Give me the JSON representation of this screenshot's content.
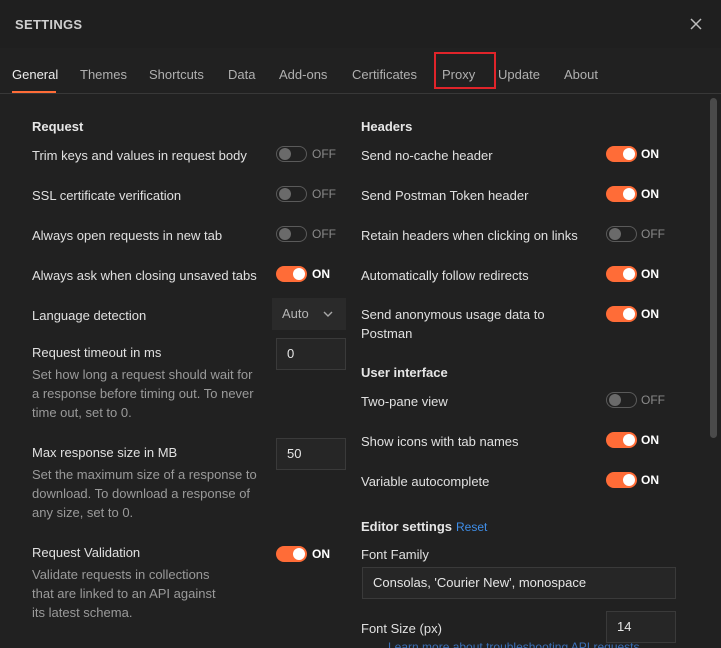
{
  "window": {
    "title": "SETTINGS"
  },
  "tabs": [
    {
      "label": "General"
    },
    {
      "label": "Themes"
    },
    {
      "label": "Shortcuts"
    },
    {
      "label": "Data"
    },
    {
      "label": "Add-ons"
    },
    {
      "label": "Certificates"
    },
    {
      "label": "Proxy"
    },
    {
      "label": "Update"
    },
    {
      "label": "About"
    }
  ],
  "active_tab": "General",
  "accent_color": "#ff6c37",
  "highlight_color": "#e0242a",
  "request": {
    "heading": "Request",
    "trim_keys": {
      "label": "Trim keys and values in request body",
      "state": "OFF"
    },
    "ssl_verification": {
      "label": "SSL certificate verification",
      "state": "OFF"
    },
    "open_new_tab": {
      "label": "Always open requests in new tab",
      "state": "OFF"
    },
    "ask_closing": {
      "label": "Always ask when closing unsaved tabs",
      "state": "ON"
    },
    "language_detection": {
      "label": "Language detection",
      "value": "Auto"
    },
    "timeout": {
      "label": "Request timeout in ms",
      "desc": "Set how long a request should wait for a response before timing out. To never time out, set to 0.",
      "value": "0"
    },
    "max_response": {
      "label": "Max response size in MB",
      "desc": "Set the maximum size of a response to download. To download a response of any size, set to 0.",
      "value": "50"
    },
    "validation": {
      "label": "Request Validation",
      "desc": "Validate requests in collections that are linked to an API against its latest schema.",
      "state": "ON"
    }
  },
  "headers": {
    "heading": "Headers",
    "no_cache": {
      "label": "Send no-cache header",
      "state": "ON"
    },
    "postman_token": {
      "label": "Send Postman Token header",
      "state": "ON"
    },
    "retain_headers": {
      "label": "Retain headers when clicking on links",
      "state": "OFF"
    },
    "follow_redirects": {
      "label": "Automatically follow redirects",
      "state": "ON"
    },
    "anon_usage": {
      "label": "Send anonymous usage data to Postman",
      "state": "ON"
    }
  },
  "ui": {
    "heading": "User interface",
    "two_pane": {
      "label": "Two-pane view",
      "state": "OFF"
    },
    "tab_icons": {
      "label": "Show icons with tab names",
      "state": "ON"
    },
    "var_autocomplete": {
      "label": "Variable autocomplete",
      "state": "ON"
    }
  },
  "editor": {
    "heading": "Editor settings",
    "reset_label": "Reset",
    "font_family": {
      "label": "Font Family",
      "value": "Consolas, 'Courier New', monospace"
    },
    "font_size": {
      "label": "Font Size (px)",
      "value": "14"
    }
  },
  "footer": {
    "link_text": "Learn more about troubleshooting API requests"
  }
}
